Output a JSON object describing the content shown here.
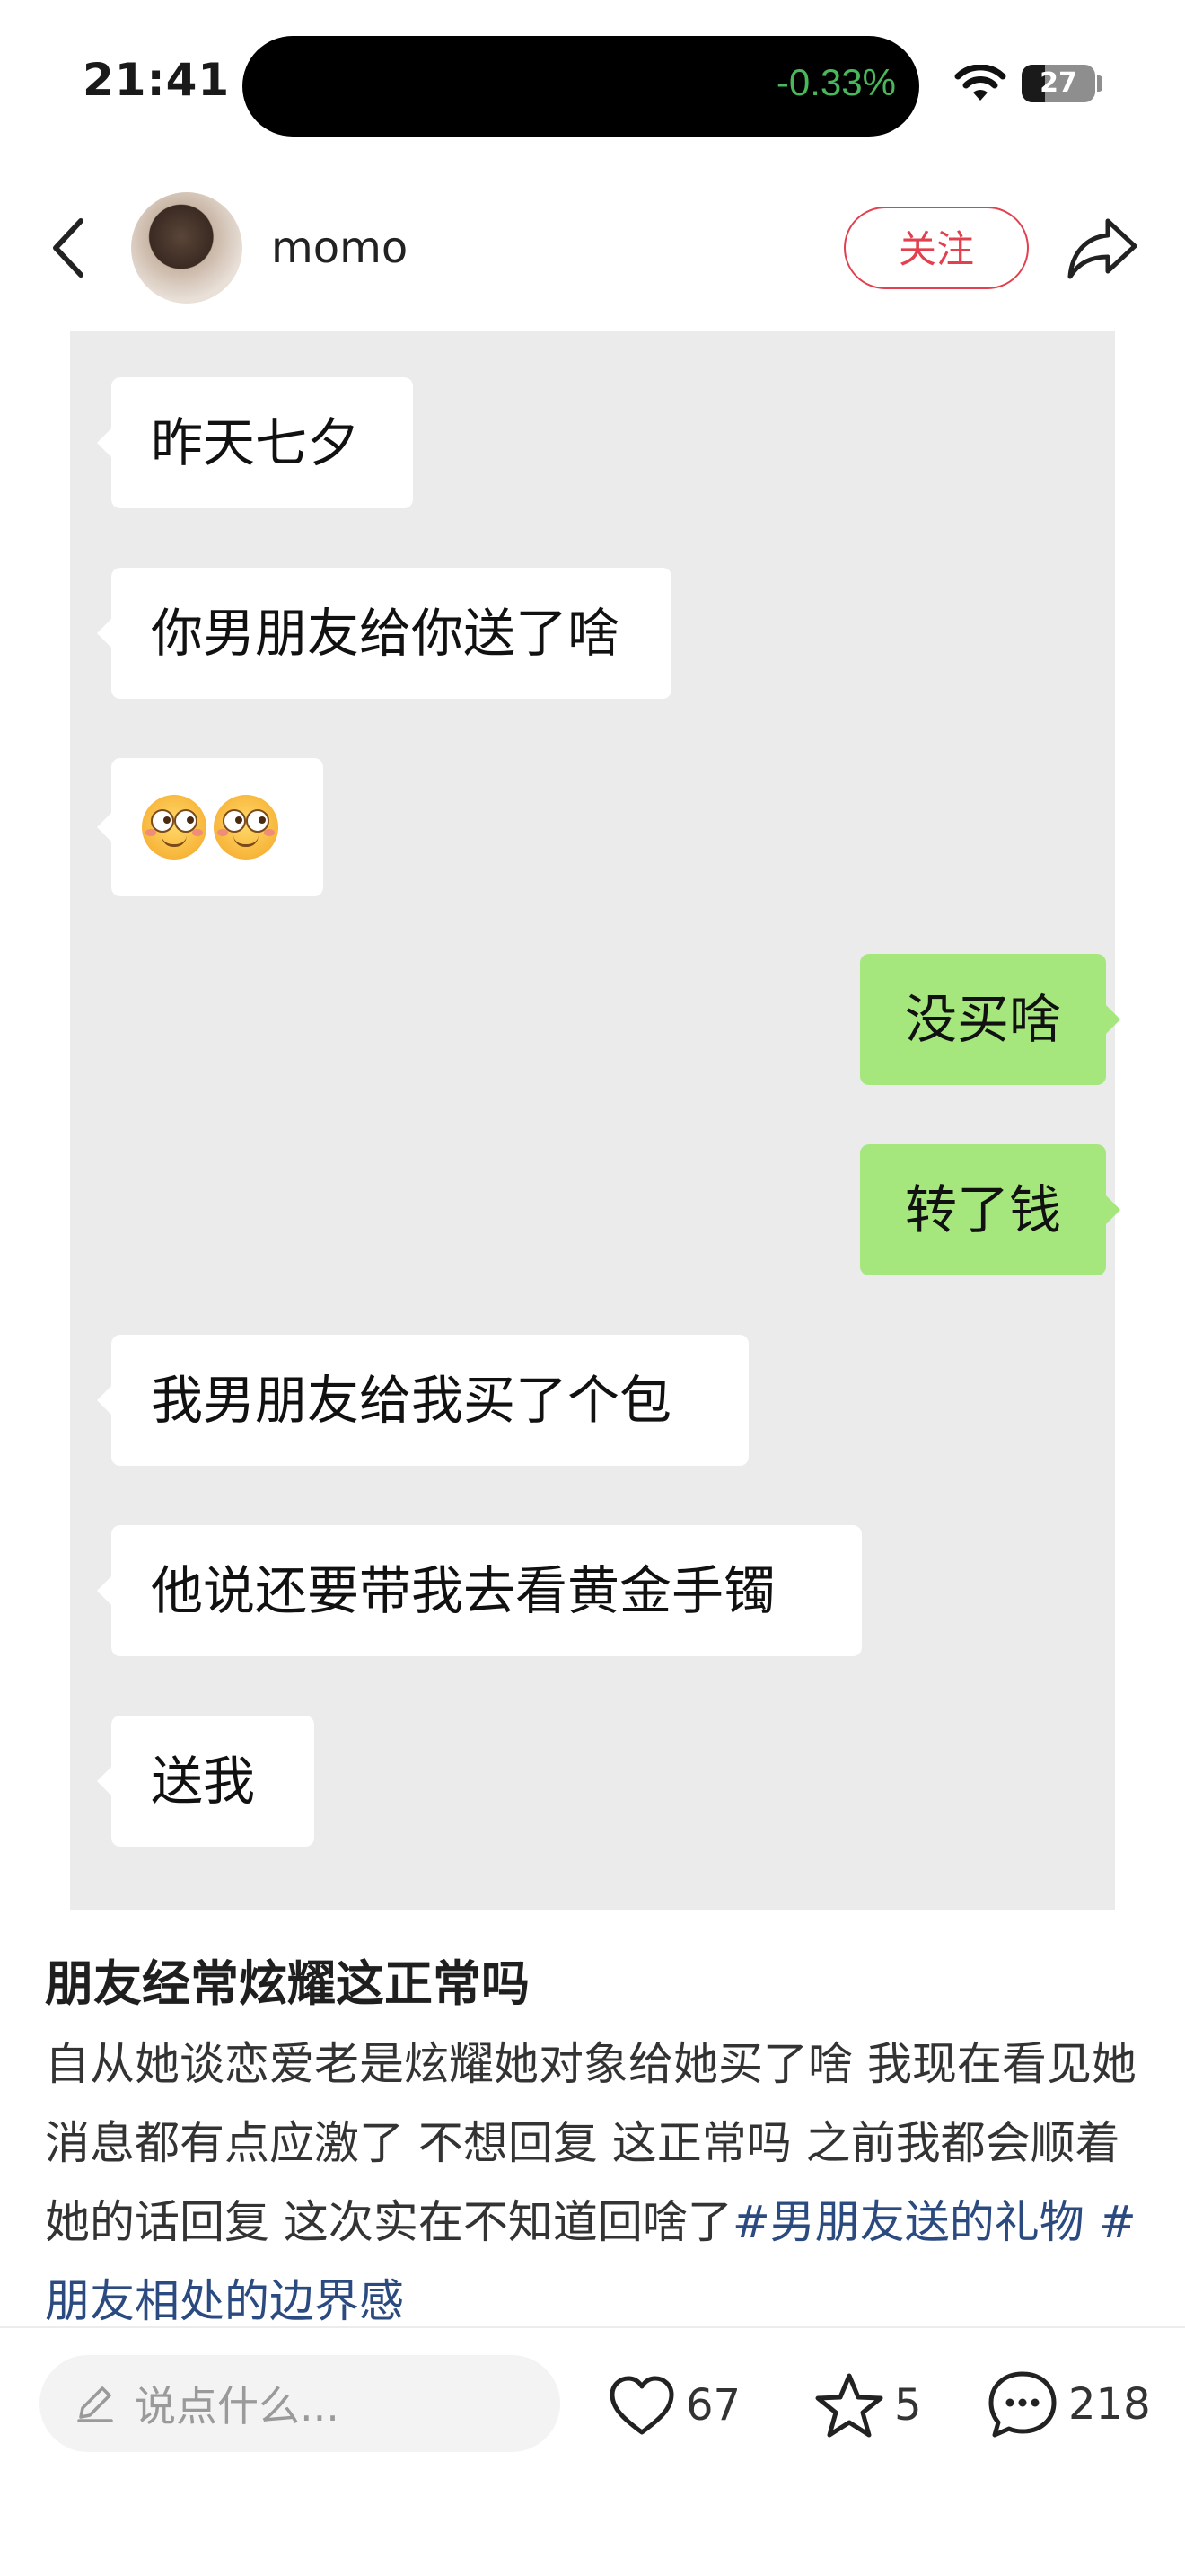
{
  "status_bar": {
    "time": "21:41",
    "island_value": "-0.33%",
    "battery": "27"
  },
  "header": {
    "username": "momo",
    "follow_label": "关注"
  },
  "chat": {
    "messages": [
      {
        "side": "in",
        "text": "昨天七夕"
      },
      {
        "side": "in",
        "text": "你男朋友给你送了啥"
      },
      {
        "side": "in",
        "text": "emoji-grin-eyes ×2"
      },
      {
        "side": "out",
        "text": "没买啥"
      },
      {
        "side": "out",
        "text": "转了钱"
      },
      {
        "side": "in",
        "text": "我男朋友给我买了个包"
      },
      {
        "side": "in",
        "text": "他说还要带我去看黄金手镯"
      },
      {
        "side": "in",
        "text": "送我"
      }
    ]
  },
  "post": {
    "title": "朋友经常炫耀这正常吗",
    "body": "自从她谈恋爱老是炫耀她对象给她买了啥  我现在看见她消息都有点应激了  不想回复  这正常吗  之前我都会顺着她的话回复  这次实在不知道回啥了",
    "tags": [
      "#男朋友送的礼物",
      "#朋友相处的边界感"
    ]
  },
  "bottom_bar": {
    "comment_placeholder": "说点什么...",
    "likes": "67",
    "favorites": "5",
    "comments": "218"
  },
  "colors": {
    "accent": "#e2404e",
    "tag": "#2b4a80",
    "out_bubble": "#a5e77c",
    "chat_bg": "#ebebeb"
  }
}
